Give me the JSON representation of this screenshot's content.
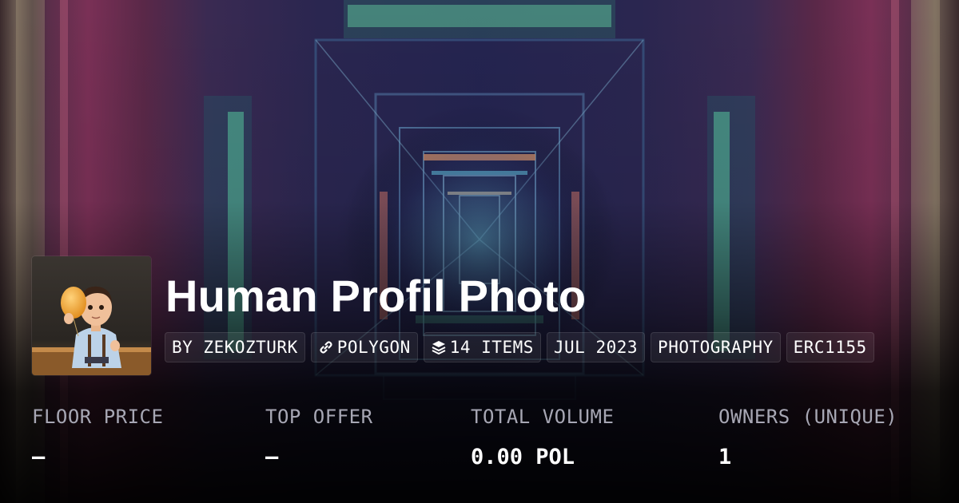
{
  "collection": {
    "title": "Human Profil Photo",
    "thumbnail_icon": "boy-holding-balloon-illustration"
  },
  "chips": [
    {
      "label": "BY ZEKOZTURK",
      "icon": ""
    },
    {
      "label": "POLYGON",
      "icon": "chain-link-icon"
    },
    {
      "label": "14 ITEMS",
      "icon": "layers-icon"
    },
    {
      "label": "JUL 2023",
      "icon": ""
    },
    {
      "label": "PHOTOGRAPHY",
      "icon": ""
    },
    {
      "label": "ERC1155",
      "icon": ""
    }
  ],
  "stats": [
    {
      "label": "FLOOR PRICE",
      "value": "–"
    },
    {
      "label": "TOP OFFER",
      "value": "–"
    },
    {
      "label": "TOTAL VOLUME",
      "value": "0.00 POL"
    },
    {
      "label": "OWNERS (UNIQUE)",
      "value": "1"
    }
  ]
}
